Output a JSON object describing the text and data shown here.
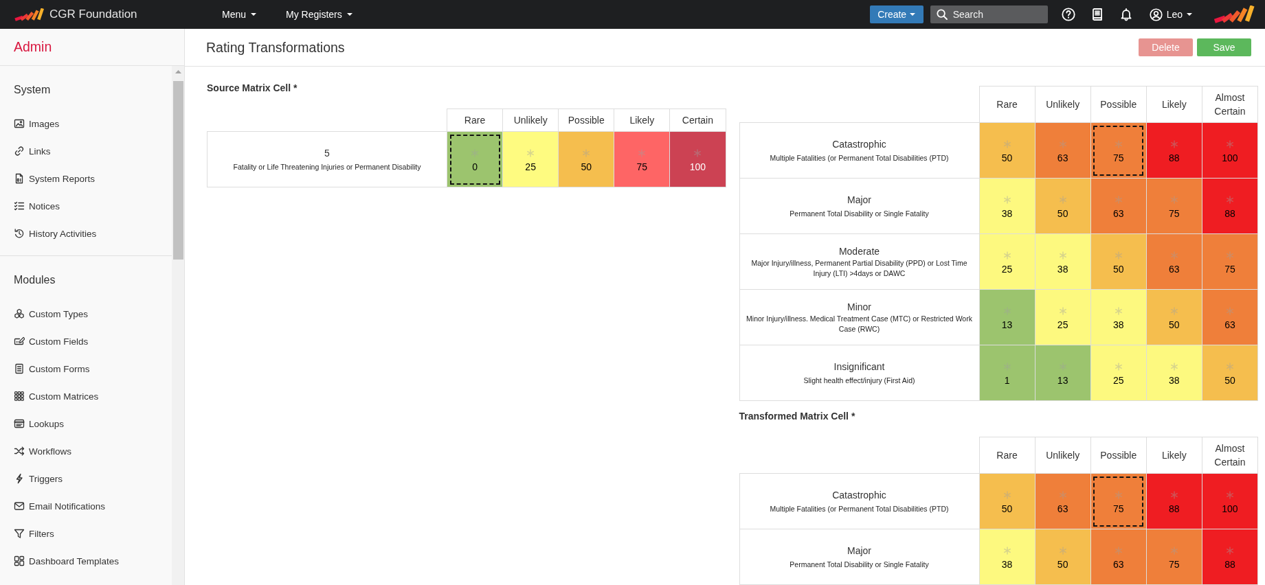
{
  "navbar": {
    "brand": "CGR Foundation",
    "menus": [
      {
        "label": "Menu"
      },
      {
        "label": "My Registers"
      }
    ],
    "create_button": {
      "label": "Create"
    },
    "search": {
      "placeholder": "Search"
    },
    "user": {
      "name": "Leo"
    }
  },
  "sidebar": {
    "title": "Admin",
    "sections": [
      {
        "heading": "System",
        "items": [
          {
            "label": "Images"
          },
          {
            "label": "Links"
          },
          {
            "label": "System Reports"
          },
          {
            "label": "Notices"
          },
          {
            "label": "History Activities"
          }
        ]
      },
      {
        "heading": "Modules",
        "items": [
          {
            "label": "Custom Types"
          },
          {
            "label": "Custom Fields"
          },
          {
            "label": "Custom Forms"
          },
          {
            "label": "Custom Matrices"
          },
          {
            "label": "Lookups"
          },
          {
            "label": "Workflows"
          },
          {
            "label": "Triggers"
          },
          {
            "label": "Email Notifications"
          },
          {
            "label": "Filters"
          },
          {
            "label": "Dashboard Templates"
          }
        ]
      }
    ]
  },
  "page": {
    "title": "Rating Transformations",
    "actions": [
      {
        "label": "Delete",
        "kind": "danger",
        "disabled": true
      },
      {
        "label": "Save",
        "kind": "success",
        "disabled": false
      }
    ]
  },
  "source_matrix": {
    "label": "Source Matrix Cell *",
    "columns": [
      "Rare",
      "Unlikely",
      "Possible",
      "Likely",
      "Certain"
    ],
    "rows": [
      {
        "title": "5",
        "description": "Fatality or Life Threatening Injuries or Permanent Disability",
        "cells": [
          {
            "value": "0",
            "color": "#9cc46e",
            "selected": true
          },
          {
            "value": "25",
            "color": "#fefb80",
            "selected": false
          },
          {
            "value": "50",
            "color": "#f5be4e",
            "selected": false
          },
          {
            "value": "75",
            "color": "#fe6565",
            "selected": false
          },
          {
            "value": "100",
            "color": "#cc4253",
            "selected": false
          }
        ]
      }
    ]
  },
  "target_matrix": {
    "columns": [
      "Rare",
      "Unlikely",
      "Possible",
      "Likely",
      "Almost Certain"
    ],
    "rows": [
      {
        "title": "Catastrophic",
        "description": "Multiple Fatalities (or Permanent Total Disabilities (PTD)",
        "cells": [
          {
            "value": "50",
            "color": "#f5be4e",
            "selected": false
          },
          {
            "value": "63",
            "color": "#ef7f3a",
            "selected": false
          },
          {
            "value": "75",
            "color": "#ef7f3a",
            "selected": true
          },
          {
            "value": "88",
            "color": "#ef1d22",
            "selected": false
          },
          {
            "value": "100",
            "color": "#ef1d22",
            "selected": false
          }
        ]
      },
      {
        "title": "Major",
        "description": "Permanent Total Disability or Single Fatality",
        "cells": [
          {
            "value": "38",
            "color": "#fdf97f",
            "selected": false
          },
          {
            "value": "50",
            "color": "#f5be4e",
            "selected": false
          },
          {
            "value": "63",
            "color": "#ef7f3a",
            "selected": false
          },
          {
            "value": "75",
            "color": "#ef7f3a",
            "selected": false
          },
          {
            "value": "88",
            "color": "#ef1d22",
            "selected": false
          }
        ]
      },
      {
        "title": "Moderate",
        "description": "Major Injury/illness, Permanent Partial Disability (PPD) or Lost Time Injury (LTI) >4days or DAWC",
        "cells": [
          {
            "value": "25",
            "color": "#fdf97f",
            "selected": false
          },
          {
            "value": "38",
            "color": "#fdf97f",
            "selected": false
          },
          {
            "value": "50",
            "color": "#f5be4e",
            "selected": false
          },
          {
            "value": "63",
            "color": "#ef7f3a",
            "selected": false
          },
          {
            "value": "75",
            "color": "#ef7f3a",
            "selected": false
          }
        ]
      },
      {
        "title": "Minor",
        "description": "Minor Injury/illness. Medical Treatment Case (MTC) or Restricted Work Case (RWC)",
        "cells": [
          {
            "value": "13",
            "color": "#9cc46e",
            "selected": false
          },
          {
            "value": "25",
            "color": "#fdf97f",
            "selected": false
          },
          {
            "value": "38",
            "color": "#fdf97f",
            "selected": false
          },
          {
            "value": "50",
            "color": "#f5be4e",
            "selected": false
          },
          {
            "value": "63",
            "color": "#ef7f3a",
            "selected": false
          }
        ]
      },
      {
        "title": "Insignificant",
        "description": "Slight health effect/injury (First Aid)",
        "cells": [
          {
            "value": "1",
            "color": "#9cc46e",
            "selected": false
          },
          {
            "value": "13",
            "color": "#9cc46e",
            "selected": false
          },
          {
            "value": "25",
            "color": "#fdf97f",
            "selected": false
          },
          {
            "value": "38",
            "color": "#fdf97f",
            "selected": false
          },
          {
            "value": "50",
            "color": "#f5be4e",
            "selected": false
          }
        ]
      }
    ]
  },
  "transformed_matrix": {
    "label": "Transformed Matrix Cell *",
    "columns": [
      "Rare",
      "Unlikely",
      "Possible",
      "Likely",
      "Almost Certain"
    ],
    "rows": [
      {
        "title": "Catastrophic",
        "description": "Multiple Fatalities (or Permanent Total Disabilities (PTD)",
        "cells": [
          {
            "value": "50",
            "color": "#f5be4e",
            "selected": false
          },
          {
            "value": "63",
            "color": "#ef7f3a",
            "selected": false
          },
          {
            "value": "75",
            "color": "#ef7f3a",
            "selected": true
          },
          {
            "value": "88",
            "color": "#ef1d22",
            "selected": false
          },
          {
            "value": "100",
            "color": "#ef1d22",
            "selected": false
          }
        ]
      },
      {
        "title": "Major",
        "description": "Permanent Total Disability or Single Fatality",
        "cells": [
          {
            "value": "38",
            "color": "#fdf97f",
            "selected": false
          },
          {
            "value": "50",
            "color": "#f5be4e",
            "selected": false
          },
          {
            "value": "63",
            "color": "#ef7f3a",
            "selected": false
          },
          {
            "value": "75",
            "color": "#ef7f3a",
            "selected": false
          },
          {
            "value": "88",
            "color": "#ef1d22",
            "selected": false
          }
        ]
      }
    ]
  }
}
